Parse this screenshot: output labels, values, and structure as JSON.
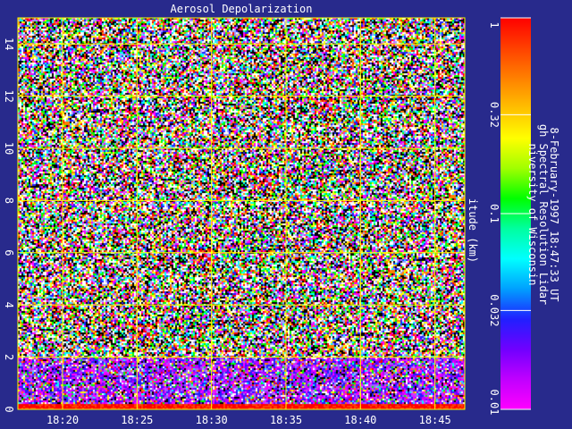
{
  "chart_data": {
    "type": "heatmap",
    "title": "Aerosol Depolarization",
    "ylabel": "itude (km)",
    "y_ticks": [
      "0",
      "2",
      "4",
      "6",
      "8",
      "10",
      "12",
      "14"
    ],
    "ylim": [
      0,
      15
    ],
    "x_ticks": [
      "18:20",
      "18:25",
      "18:30",
      "18:35",
      "18:40",
      "18:45"
    ],
    "xlim": [
      "18:17",
      "18:47"
    ],
    "grid": true,
    "grid_color": "#ffff00",
    "plot_background": "#282a8c",
    "colorbar": {
      "scale": "log",
      "range": [
        0.01,
        1
      ],
      "ticks": [
        "1",
        "0.32",
        "0.1",
        "0.032",
        "0.01"
      ],
      "colors": [
        "#ff00ff",
        "#c000ff",
        "#7000ff",
        "#2020ff",
        "#00a0ff",
        "#00ffff",
        "#00ffa0",
        "#00ff00",
        "#a0ff00",
        "#ffff00",
        "#ffc000",
        "#ff8000",
        "#ff4000",
        "#ff0000"
      ]
    },
    "footer_lines": [
      "niversity of Wisconsin",
      "gh Spectral Resolution Lidar",
      "8-February-1997 18:47:33 UT"
    ]
  }
}
